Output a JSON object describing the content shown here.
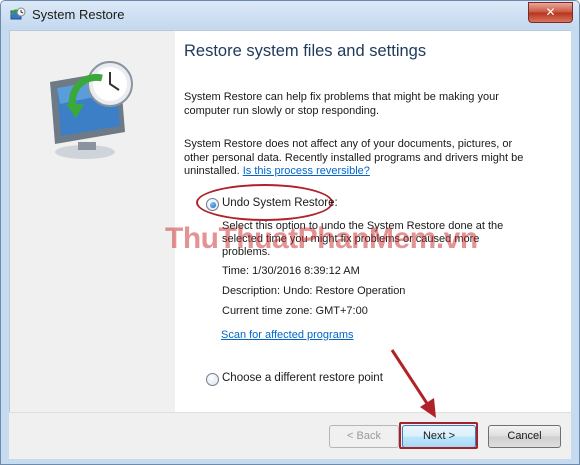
{
  "window": {
    "title": "System Restore",
    "close_symbol": "✕"
  },
  "content": {
    "heading": "Restore system files and settings",
    "intro": "System Restore can help fix problems that might be making your computer run slowly or stop responding.",
    "notice": "System Restore does not affect any of your documents, pictures, or other personal data. Recently installed programs and drivers might be uninstalled.",
    "reversible_link": "Is this process reversible?",
    "options": [
      {
        "label": "Undo System Restore:",
        "checked": true,
        "description": "Select this option to undo the System Restore done at the selected time you might fix problems or caused more problems."
      },
      {
        "label": "Choose a different restore point",
        "checked": false
      }
    ],
    "time": "Time: 1/30/2016 8:39:12 AM",
    "description": "Description: Undo: Restore Operation",
    "timezone": "Current time zone: GMT+7:00",
    "scan_link": "Scan for affected programs"
  },
  "buttons": {
    "back": "< Back",
    "next": "Next >",
    "cancel": "Cancel"
  },
  "watermark": "ThuThuatPhanMem.vn",
  "icons": [
    "system-restore-icon",
    "system-restore-hero-icon",
    "close-icon",
    "annotation-arrow"
  ],
  "colors": {
    "annotation": "#b0222a",
    "link": "#0066cc",
    "heading": "#1e395b"
  }
}
